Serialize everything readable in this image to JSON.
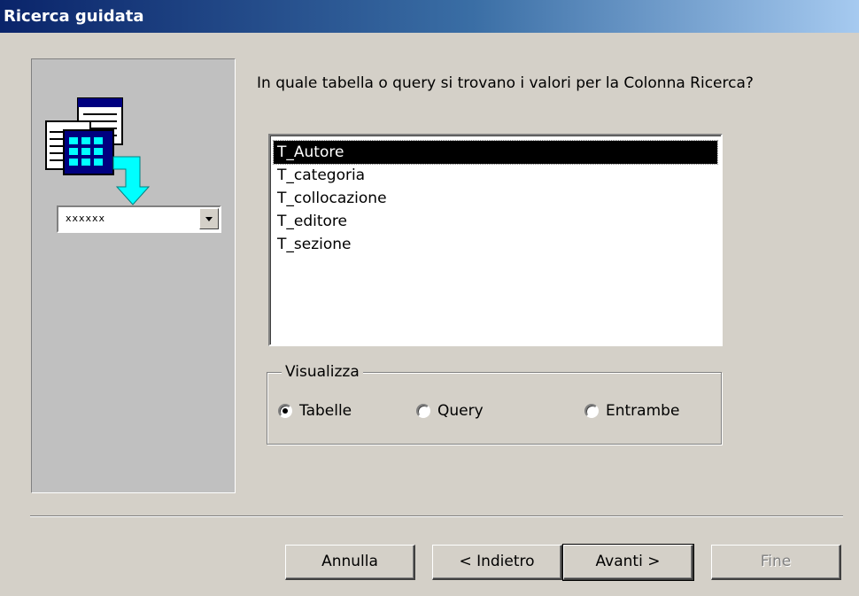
{
  "window": {
    "title": "Ricerca guidata"
  },
  "illustration": {
    "combo_text": "xxxxxx",
    "icon_name": "table-lookup-icon"
  },
  "prompt": "In quale tabella o query si trovano i valori per la Colonna Ricerca?",
  "list": {
    "items": [
      "T_Autore",
      "T_categoria",
      "T_collocazione",
      "T_editore",
      "T_sezione"
    ],
    "selected_index": 0
  },
  "view_group": {
    "legend": "Visualizza",
    "options": [
      {
        "label": "Tabelle",
        "checked": true
      },
      {
        "label": "Query",
        "checked": false
      },
      {
        "label": "Entrambe",
        "checked": false
      }
    ]
  },
  "buttons": {
    "cancel": "Annulla",
    "back": "< Indietro",
    "next": "Avanti >",
    "finish": "Fine"
  }
}
